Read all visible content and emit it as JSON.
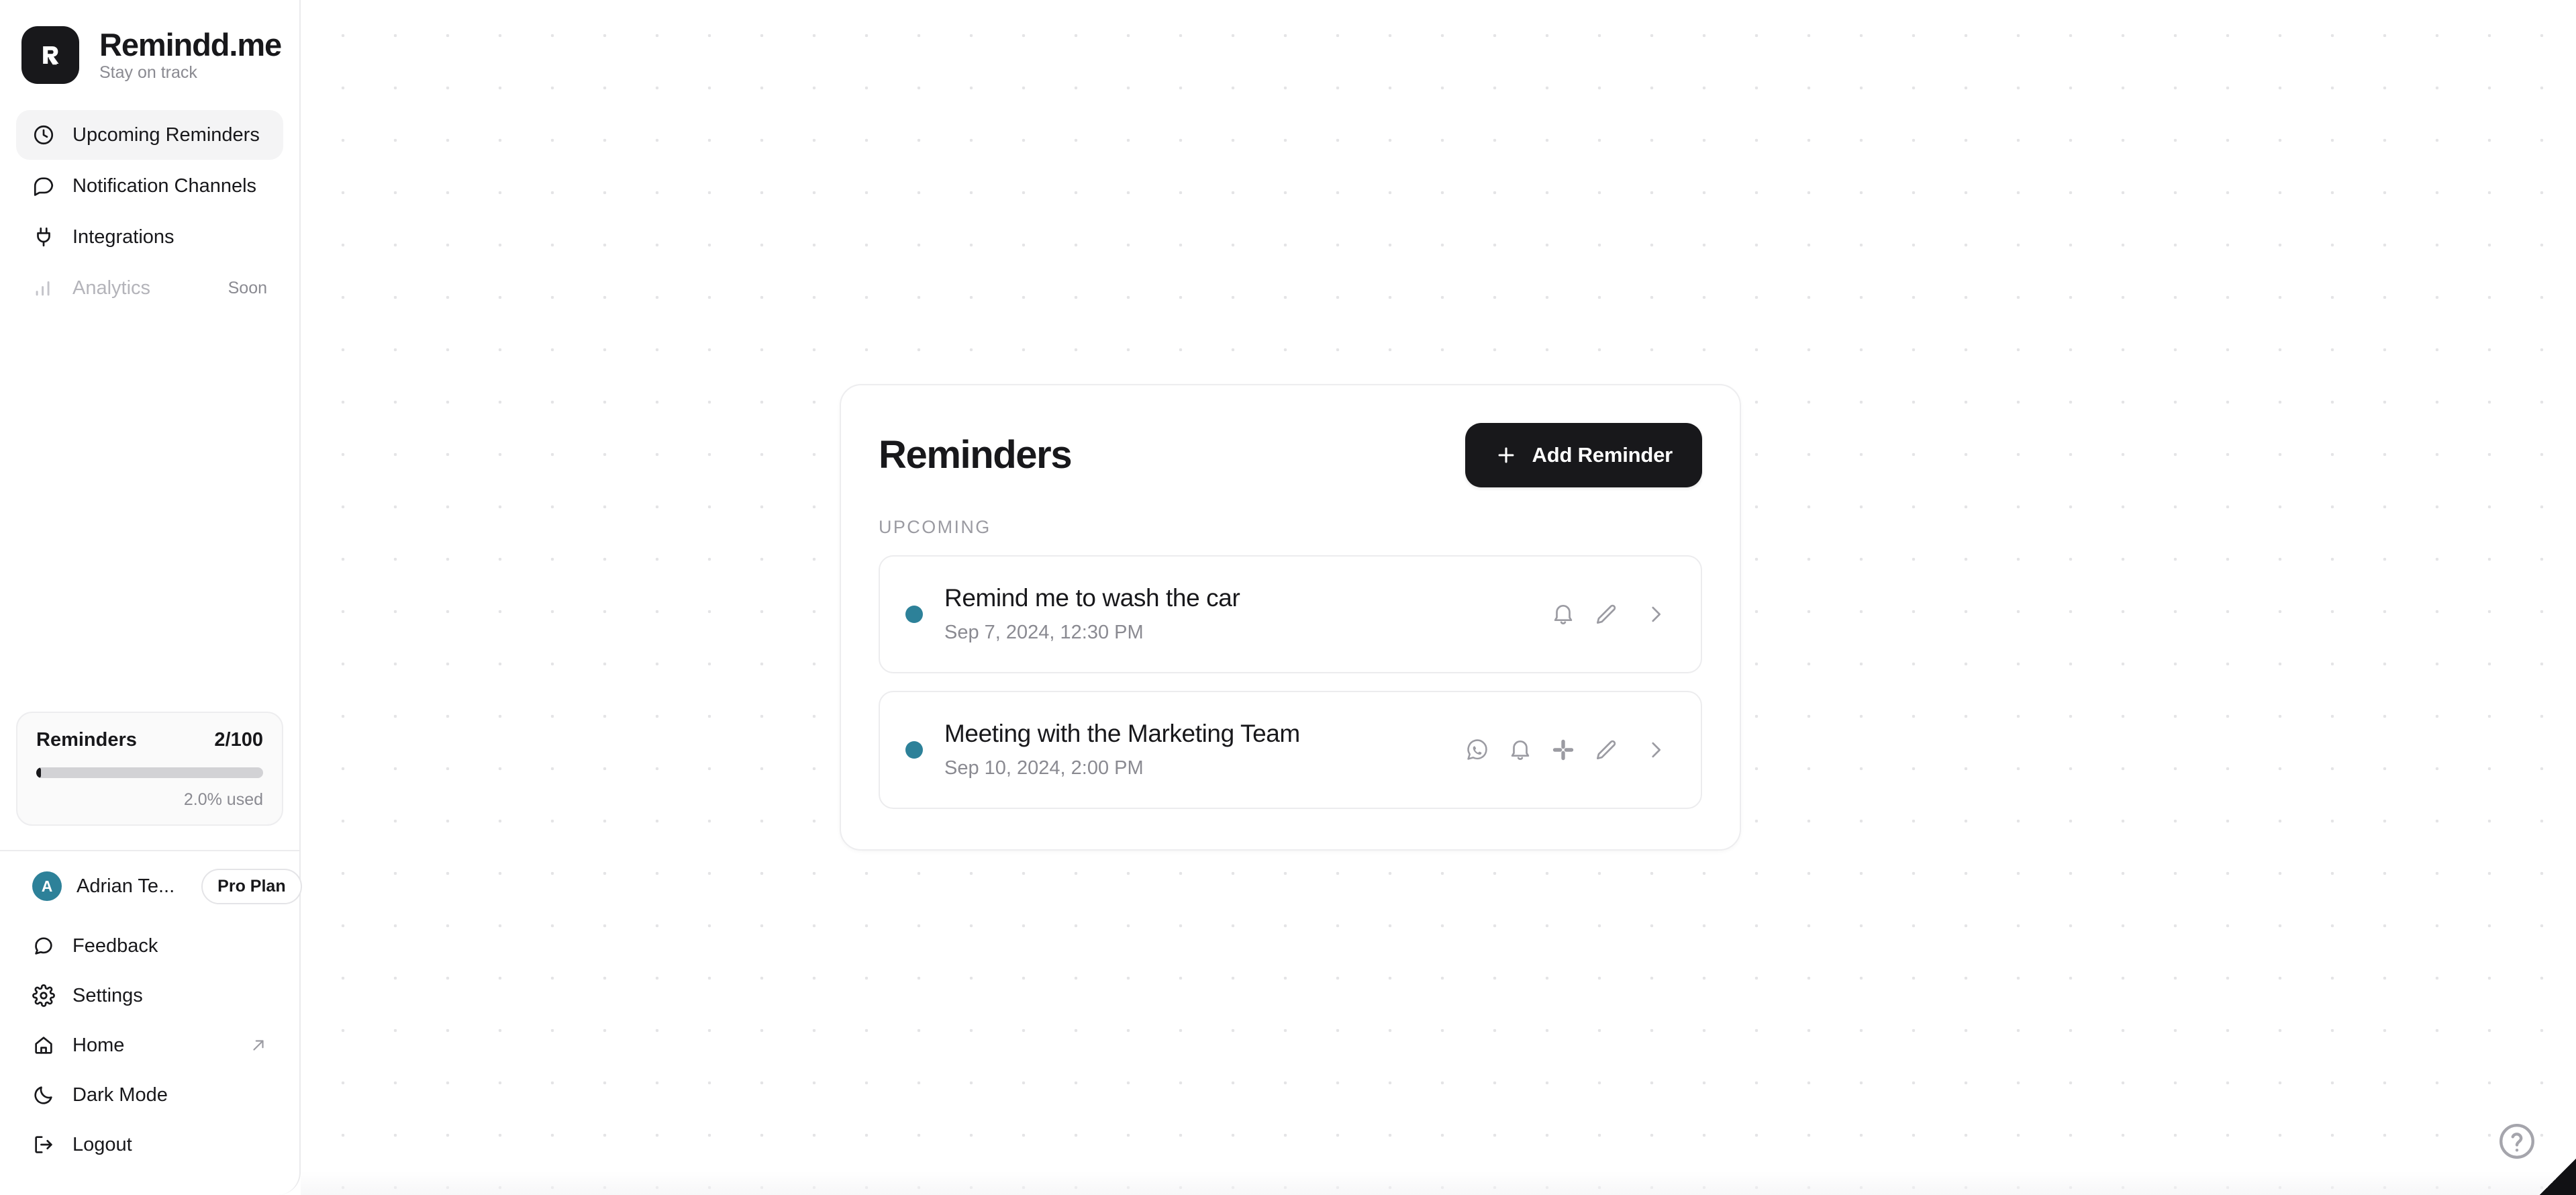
{
  "brand": {
    "name": "Remindd.me",
    "tagline": "Stay on track",
    "logo_letter": "R",
    "logo_icon": "logo-r-mark"
  },
  "sidebar": {
    "nav_items": [
      {
        "label": "Upcoming Reminders",
        "icon": "clock-icon",
        "active": true
      },
      {
        "label": "Notification Channels",
        "icon": "message-square-icon",
        "active": false
      },
      {
        "label": "Integrations",
        "icon": "plug-icon",
        "active": false
      },
      {
        "label": "Analytics",
        "icon": "bar-chart-icon",
        "active": false,
        "badge": "Soon",
        "disabled": true
      }
    ],
    "usage": {
      "title": "Reminders",
      "count": "2/100",
      "used_label": "2.0% used",
      "percent": 2.0
    },
    "account": {
      "avatar_letter": "A",
      "name": "Adrian Te...",
      "plan": "Pro Plan",
      "avatar_color": "#2d8199"
    },
    "bottom_items": [
      {
        "label": "Feedback",
        "icon": "message-circle-icon"
      },
      {
        "label": "Settings",
        "icon": "gear-icon"
      },
      {
        "label": "Home",
        "icon": "home-icon",
        "external": true
      },
      {
        "label": "Dark Mode",
        "icon": "moon-icon"
      },
      {
        "label": "Logout",
        "icon": "logout-icon"
      }
    ]
  },
  "main": {
    "card": {
      "title": "Reminders",
      "add_button": "Add Reminder",
      "section_label": "UPCOMING",
      "reminders": [
        {
          "title": "Remind me to wash the car",
          "time": "Sep 7, 2024, 12:30 PM",
          "dot_color": "#2d8199",
          "actions": [
            "bell-icon",
            "pencil-icon",
            "chevron-right-icon"
          ]
        },
        {
          "title": "Meeting with the Marketing Team",
          "time": "Sep 10, 2024, 2:00 PM",
          "dot_color": "#2d8199",
          "actions": [
            "whatsapp-icon",
            "bell-icon",
            "slack-icon",
            "pencil-icon",
            "chevron-right-icon"
          ]
        }
      ]
    },
    "help_button": "?"
  },
  "colors": {
    "accent_dark": "#18181b",
    "teal": "#2d8199",
    "muted_text": "#8a8a91",
    "border": "#ececee"
  }
}
